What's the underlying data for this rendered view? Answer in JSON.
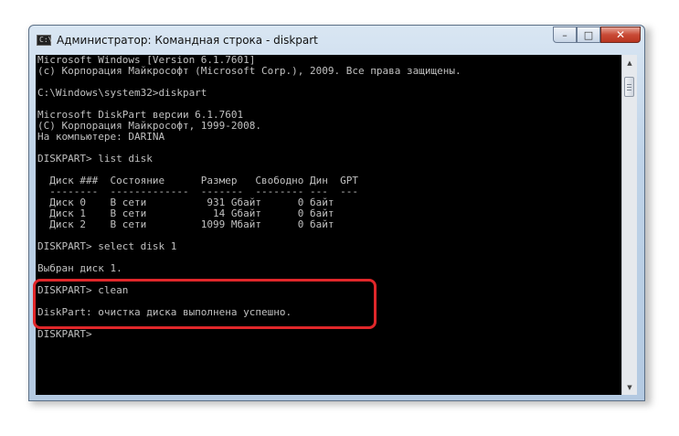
{
  "window": {
    "title": "Администратор: Командная строка - diskpart",
    "icon": "cmd-icon",
    "icon_text": "C:\\",
    "controls": {
      "minimize": "–",
      "maximize": "□",
      "close": "✕"
    }
  },
  "console": {
    "lines": [
      "Microsoft Windows [Version 6.1.7601]",
      "(c) Корпорация Майкрософт (Microsoft Corp.), 2009. Все права защищены.",
      "",
      "C:\\Windows\\system32>diskpart",
      "",
      "Microsoft DiskPart версии 6.1.7601",
      "(C) Корпорация Майкрософт, 1999-2008.",
      "На компьютере: DARINA",
      "",
      "DISKPART> list disk",
      "",
      "  Диск ###  Состояние      Размер   Свободно Дин  GPT",
      "  --------  -------------  -------  -------- ---  ---",
      "  Диск 0    В сети          931 Gбайт      0 байт",
      "  Диск 1    В сети           14 Gбайт      0 байт",
      "  Диск 2    В сети         1099 Мбайт      0 байт",
      "",
      "DISKPART> select disk 1",
      "",
      "Выбран диск 1.",
      "",
      "DISKPART> clean",
      "",
      "DiskPart: очистка диска выполнена успешно.",
      "",
      "DISKPART> "
    ],
    "colors": {
      "background": "#000000",
      "text": "#c0c0c0"
    }
  },
  "scrollbar": {
    "up_arrow": "▲",
    "down_arrow": "▼"
  },
  "highlight": {
    "color": "#e0272a"
  }
}
